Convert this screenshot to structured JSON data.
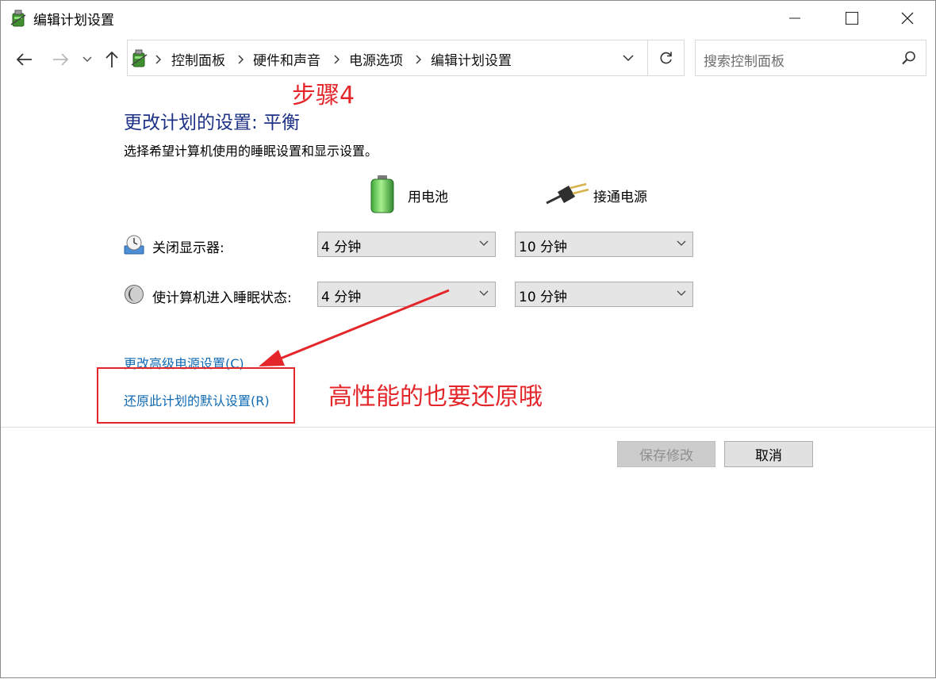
{
  "window": {
    "title": "编辑计划设置",
    "controls": {
      "minimize": "minimize",
      "maximize": "maximize",
      "close": "close"
    }
  },
  "nav": {
    "breadcrumb": [
      "控制面板",
      "硬件和声音",
      "电源选项",
      "编辑计划设置"
    ],
    "search_placeholder": "搜索控制面板"
  },
  "annotations": {
    "step": "步骤4",
    "note": "高性能的也要还原哦",
    "color": "#e4262a"
  },
  "main": {
    "heading": "更改计划的设置: 平衡",
    "subtext": "选择希望计算机使用的睡眠设置和显示设置。",
    "columns": {
      "battery": "用电池",
      "plugged_in": "接通电源"
    },
    "rows": [
      {
        "label": "关闭显示器:",
        "battery": "4 分钟",
        "plugged_in": "10 分钟",
        "icon": "display-off-icon"
      },
      {
        "label": "使计算机进入睡眠状态:",
        "battery": "4 分钟",
        "plugged_in": "10 分钟",
        "icon": "sleep-moon-icon"
      }
    ],
    "links": {
      "advanced": "更改高级电源设置(C)",
      "restore": "还原此计划的默认设置(R)"
    },
    "link_color": "#0f6ab4",
    "heading_color": "#1e3287"
  },
  "footer": {
    "save": "保存修改",
    "cancel": "取消"
  }
}
